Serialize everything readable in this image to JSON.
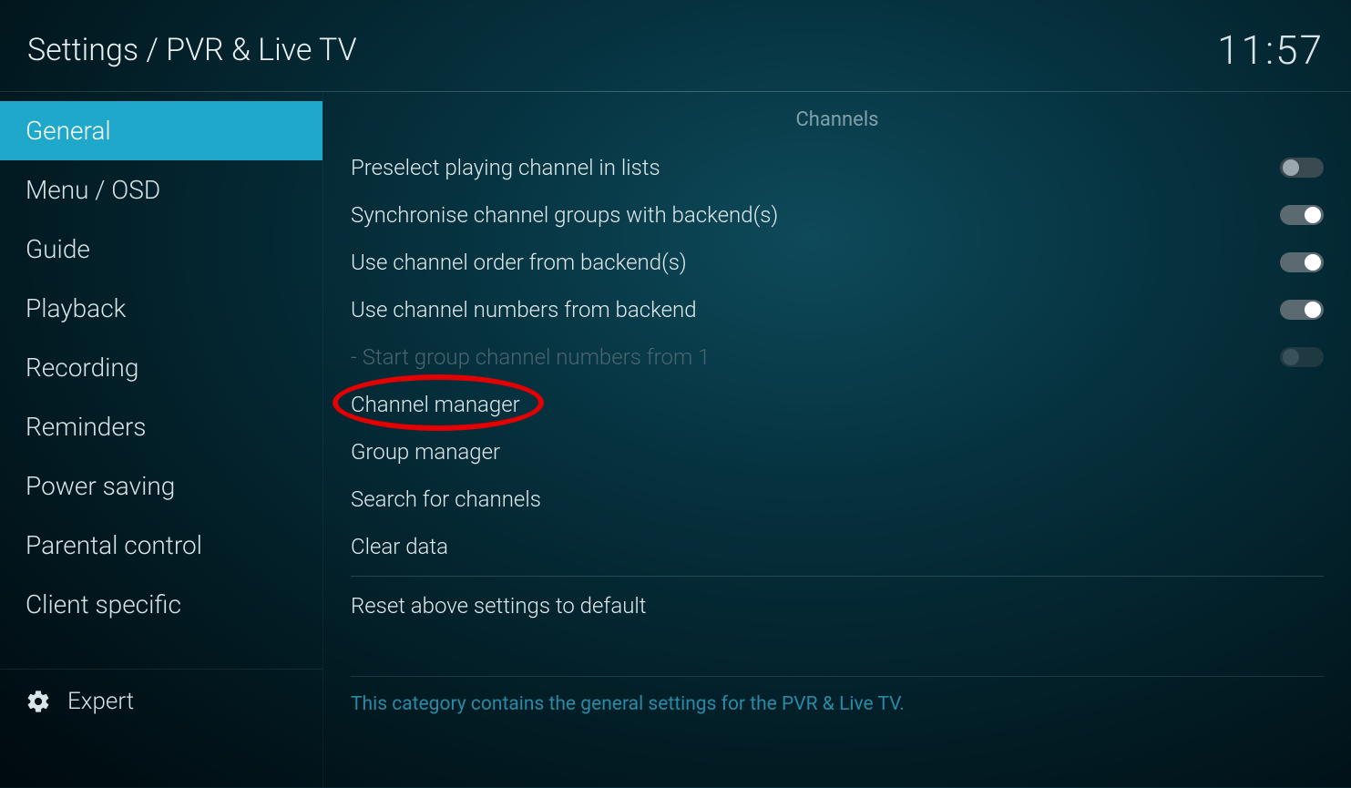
{
  "header": {
    "breadcrumb": "Settings / PVR & Live TV",
    "clock": "11:57"
  },
  "sidebar": {
    "items": [
      {
        "label": "General",
        "active": true
      },
      {
        "label": "Menu / OSD",
        "active": false
      },
      {
        "label": "Guide",
        "active": false
      },
      {
        "label": "Playback",
        "active": false
      },
      {
        "label": "Recording",
        "active": false
      },
      {
        "label": "Reminders",
        "active": false
      },
      {
        "label": "Power saving",
        "active": false
      },
      {
        "label": "Parental control",
        "active": false
      },
      {
        "label": "Client specific",
        "active": false
      }
    ],
    "footer_label": "Expert"
  },
  "main": {
    "section_title": "Channels",
    "settings": [
      {
        "label": "Preselect playing channel in lists",
        "type": "toggle",
        "value": false,
        "disabled": false
      },
      {
        "label": "Synchronise channel groups with backend(s)",
        "type": "toggle",
        "value": true,
        "disabled": false
      },
      {
        "label": "Use channel order from backend(s)",
        "type": "toggle",
        "value": true,
        "disabled": false
      },
      {
        "label": "Use channel numbers from backend",
        "type": "toggle",
        "value": true,
        "disabled": false
      },
      {
        "label": "- Start group channel numbers from 1",
        "type": "toggle",
        "value": false,
        "disabled": true
      },
      {
        "label": "Channel manager",
        "type": "action",
        "disabled": false
      },
      {
        "label": "Group manager",
        "type": "action",
        "disabled": false
      },
      {
        "label": "Search for channels",
        "type": "action",
        "disabled": false
      },
      {
        "label": "Clear data",
        "type": "action",
        "disabled": false
      }
    ],
    "reset_label": "Reset above settings to default",
    "help_text": "This category contains the general settings for the PVR & Live TV."
  },
  "annotation": {
    "circled_item_index": 5
  }
}
